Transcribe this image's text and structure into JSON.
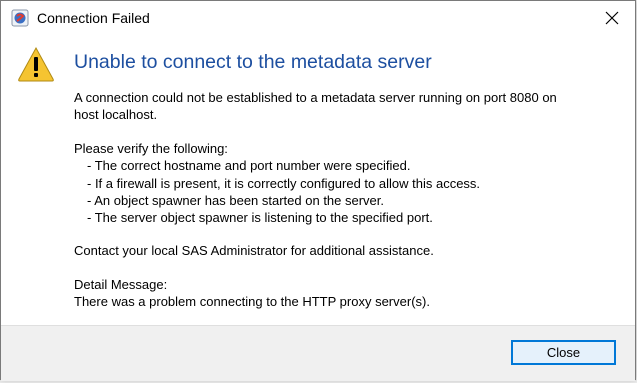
{
  "window": {
    "title": "Connection Failed"
  },
  "message": {
    "heading": "Unable to connect to the metadata server",
    "intro_line1": "A connection could not be established to a metadata server running on port 8080 on",
    "intro_line2": "host localhost.",
    "verify_header": "Please verify the following:",
    "verify_items": [
      "- The correct hostname and port number were specified.",
      "- If a firewall is present, it is correctly configured to allow this access.",
      "- An object spawner has been started on the server.",
      "- The server object spawner is listening to the specified port."
    ],
    "contact": "Contact your local SAS Administrator for additional assistance.",
    "detail_header": "Detail Message:",
    "detail_text": "There was a problem connecting to the HTTP proxy server(s)."
  },
  "buttons": {
    "close_label": "Close"
  },
  "colors": {
    "heading": "#1d4fa0",
    "button_border": "#0078d7",
    "warning_fill": "#f5c431"
  },
  "icons": {
    "app": "sas-app-icon",
    "warning": "warning-icon",
    "close": "close-icon"
  }
}
